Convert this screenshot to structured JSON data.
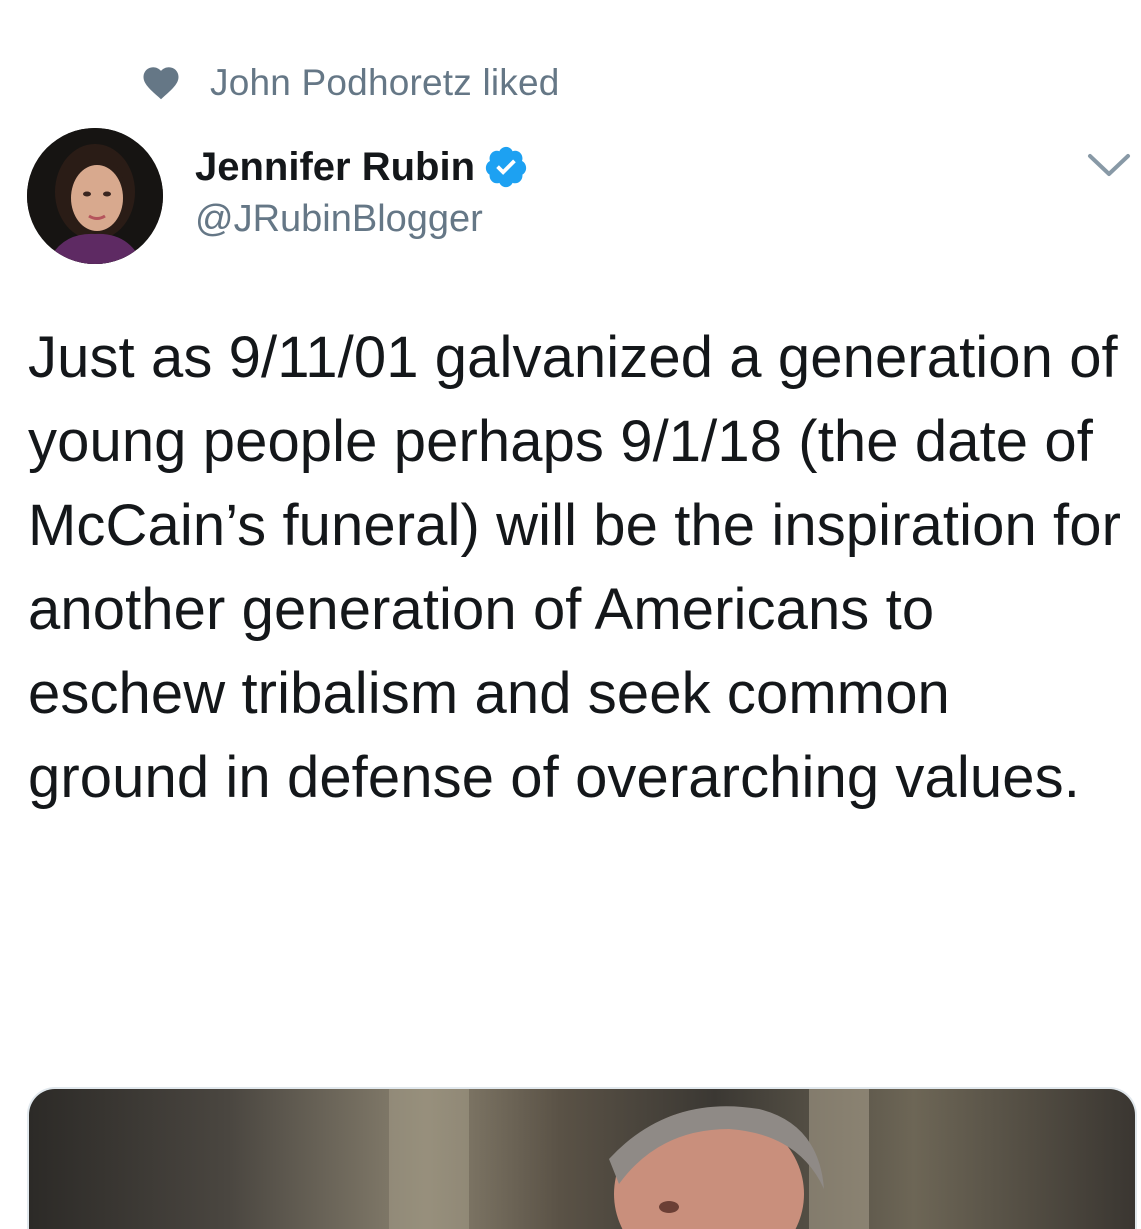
{
  "social_context": {
    "icon": "heart-icon",
    "text": "John Podhoretz liked"
  },
  "author": {
    "name": "Jennifer Rubin",
    "handle": "@JRubinBlogger",
    "verified": true,
    "verified_color": "#1da1f2"
  },
  "tweet": {
    "text": "Just as 9/11/01 galvanized a generation of young people perhaps 9/1/18 (the date of McCain’s funeral) will be the inspiration for another generation of Americans to eschew tribalism and seek common ground in defense of overarching values."
  },
  "menu": {
    "icon": "chevron-down-icon"
  },
  "colors": {
    "secondary_text": "#657786",
    "primary_text": "#14171a",
    "accent": "#1da1f2"
  }
}
